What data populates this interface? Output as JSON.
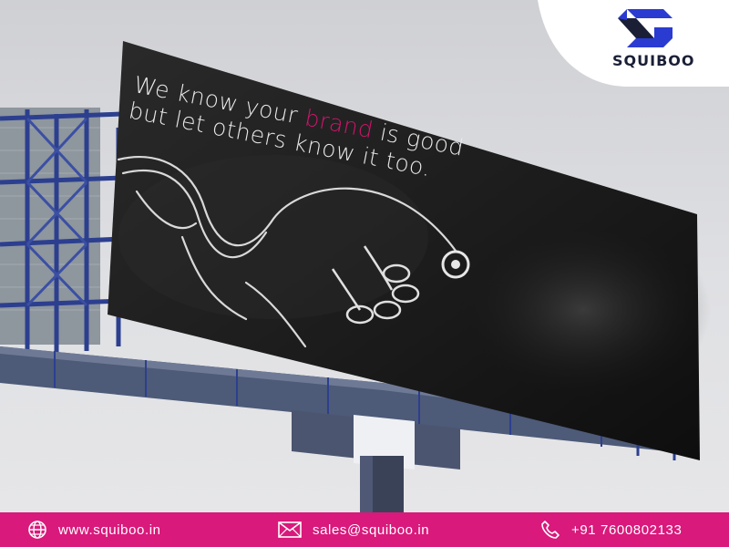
{
  "billboard": {
    "headline_line1_before": "We know your ",
    "headline_brand_word": "brand",
    "headline_line1_after": " is good",
    "headline_line2": "but let others know it too."
  },
  "logo": {
    "name": "SQUIBOO",
    "icon": "squiboo-logo-icon"
  },
  "footer": {
    "website": "www.squiboo.in",
    "email": "sales@squiboo.in",
    "phone": "+91 7600802133",
    "icons": [
      "globe-icon",
      "envelope-icon",
      "phone-icon"
    ]
  },
  "colors": {
    "brand_magenta": "#d9197b",
    "logo_blue": "#2a3bd1",
    "logo_navy": "#1a1f36",
    "billboard_dark": "#1f1f1f"
  }
}
